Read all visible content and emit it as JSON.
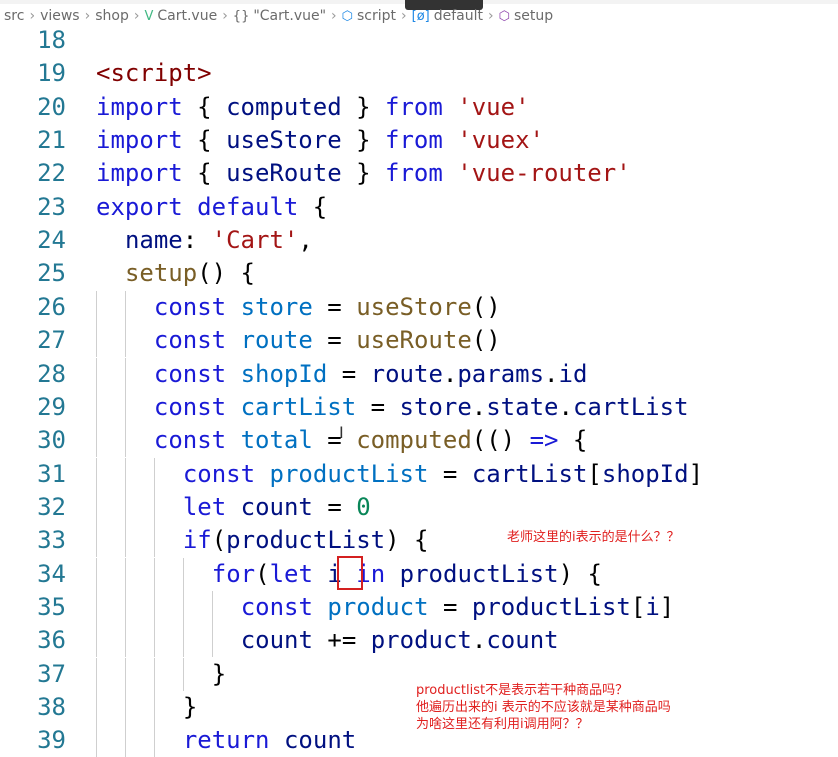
{
  "breadcrumb": [
    {
      "label": "src",
      "icon": ""
    },
    {
      "label": "views",
      "icon": ""
    },
    {
      "label": "shop",
      "icon": ""
    },
    {
      "label": "Cart.vue",
      "icon": "vue-icon"
    },
    {
      "label": "\"Cart.vue\"",
      "icon": "braces-icon"
    },
    {
      "label": "script",
      "icon": "cube-icon"
    },
    {
      "label": "default",
      "icon": "variable-icon"
    },
    {
      "label": "setup",
      "icon": "method-icon"
    }
  ],
  "colors": {
    "keyword": "#1a1ad6",
    "variable": "#0070c1",
    "function": "#795e26",
    "string": "#a31515",
    "number": "#098658",
    "annotation": "#e0201f"
  },
  "lines": [
    {
      "n": "18",
      "indent": 0,
      "tokens": []
    },
    {
      "n": "19",
      "indent": 0,
      "tokens": [
        [
          "<script>",
          "tag"
        ]
      ]
    },
    {
      "n": "20",
      "indent": 0,
      "tokens": [
        [
          "import",
          "kw"
        ],
        [
          " { ",
          "pl"
        ],
        [
          "computed",
          "txt"
        ],
        [
          " } ",
          "pl"
        ],
        [
          "from",
          "kw"
        ],
        [
          " ",
          "pl"
        ],
        [
          "'vue'",
          "str"
        ]
      ]
    },
    {
      "n": "21",
      "indent": 0,
      "tokens": [
        [
          "import",
          "kw"
        ],
        [
          " { ",
          "pl"
        ],
        [
          "useStore",
          "txt"
        ],
        [
          " } ",
          "pl"
        ],
        [
          "from",
          "kw"
        ],
        [
          " ",
          "pl"
        ],
        [
          "'vuex'",
          "str"
        ]
      ]
    },
    {
      "n": "22",
      "indent": 0,
      "tokens": [
        [
          "import",
          "kw"
        ],
        [
          " { ",
          "pl"
        ],
        [
          "useRoute",
          "txt"
        ],
        [
          " } ",
          "pl"
        ],
        [
          "from",
          "kw"
        ],
        [
          " ",
          "pl"
        ],
        [
          "'vue-router'",
          "str"
        ]
      ]
    },
    {
      "n": "23",
      "indent": 0,
      "tokens": [
        [
          "export",
          "kw"
        ],
        [
          " ",
          "pl"
        ],
        [
          "default",
          "kw"
        ],
        [
          " {",
          "pl"
        ]
      ]
    },
    {
      "n": "24",
      "indent": 1,
      "tokens": [
        [
          "name",
          "txt"
        ],
        [
          ": ",
          "pl"
        ],
        [
          "'Cart'",
          "str"
        ],
        [
          ",",
          "pl"
        ]
      ]
    },
    {
      "n": "25",
      "indent": 1,
      "tokens": [
        [
          "setup",
          "fn"
        ],
        [
          "() {",
          "pl"
        ]
      ]
    },
    {
      "n": "26",
      "indent": 2,
      "tokens": [
        [
          "const",
          "kw"
        ],
        [
          " ",
          "pl"
        ],
        [
          "store",
          "var"
        ],
        [
          " = ",
          "pl"
        ],
        [
          "useStore",
          "fn"
        ],
        [
          "()",
          "pl"
        ]
      ]
    },
    {
      "n": "27",
      "indent": 2,
      "tokens": [
        [
          "const",
          "kw"
        ],
        [
          " ",
          "pl"
        ],
        [
          "route",
          "var"
        ],
        [
          " = ",
          "pl"
        ],
        [
          "useRoute",
          "fn"
        ],
        [
          "()",
          "pl"
        ]
      ]
    },
    {
      "n": "28",
      "indent": 2,
      "tokens": [
        [
          "const",
          "kw"
        ],
        [
          " ",
          "pl"
        ],
        [
          "shopId",
          "var"
        ],
        [
          " = ",
          "pl"
        ],
        [
          "route",
          "txt"
        ],
        [
          ".",
          "pl"
        ],
        [
          "params",
          "txt"
        ],
        [
          ".",
          "pl"
        ],
        [
          "id",
          "txt"
        ]
      ]
    },
    {
      "n": "29",
      "indent": 2,
      "tokens": [
        [
          "const",
          "kw"
        ],
        [
          " ",
          "pl"
        ],
        [
          "cartList",
          "var"
        ],
        [
          " = ",
          "pl"
        ],
        [
          "store",
          "txt"
        ],
        [
          ".",
          "pl"
        ],
        [
          "state",
          "txt"
        ],
        [
          ".",
          "pl"
        ],
        [
          "cartList",
          "txt"
        ]
      ]
    },
    {
      "n": "30",
      "indent": 2,
      "tokens": [
        [
          "const",
          "kw"
        ],
        [
          " ",
          "pl"
        ],
        [
          "total",
          "var"
        ],
        [
          " = ",
          "pl"
        ],
        [
          "computed",
          "fn"
        ],
        [
          "(() ",
          "pl"
        ],
        [
          "=>",
          "kw"
        ],
        [
          " {",
          "pl"
        ]
      ]
    },
    {
      "n": "31",
      "indent": 3,
      "tokens": [
        [
          "const",
          "kw"
        ],
        [
          " ",
          "pl"
        ],
        [
          "productList",
          "var"
        ],
        [
          " = ",
          "pl"
        ],
        [
          "cartList",
          "txt"
        ],
        [
          "[",
          "pl"
        ],
        [
          "shopId",
          "txt"
        ],
        [
          "]",
          "pl"
        ]
      ]
    },
    {
      "n": "32",
      "indent": 3,
      "tokens": [
        [
          "let",
          "kw"
        ],
        [
          " ",
          "pl"
        ],
        [
          "count",
          "txt"
        ],
        [
          " = ",
          "pl"
        ],
        [
          "0",
          "num"
        ]
      ]
    },
    {
      "n": "33",
      "indent": 3,
      "tokens": [
        [
          "if",
          "kw"
        ],
        [
          "(",
          "pl"
        ],
        [
          "productList",
          "txt"
        ],
        [
          ") {",
          "pl"
        ]
      ]
    },
    {
      "n": "34",
      "indent": 4,
      "tokens": [
        [
          "for",
          "kw"
        ],
        [
          "(",
          "pl"
        ],
        [
          "let",
          "kw"
        ],
        [
          " ",
          "pl"
        ],
        [
          "i",
          "txt"
        ],
        [
          " ",
          "pl"
        ],
        [
          "in",
          "kw"
        ],
        [
          " ",
          "pl"
        ],
        [
          "productList",
          "txt"
        ],
        [
          ") {",
          "pl"
        ]
      ]
    },
    {
      "n": "35",
      "indent": 5,
      "tokens": [
        [
          "const",
          "kw"
        ],
        [
          " ",
          "pl"
        ],
        [
          "product",
          "var"
        ],
        [
          " = ",
          "pl"
        ],
        [
          "productList",
          "txt"
        ],
        [
          "[",
          "pl"
        ],
        [
          "i",
          "txt"
        ],
        [
          "]",
          "pl"
        ]
      ]
    },
    {
      "n": "36",
      "indent": 5,
      "tokens": [
        [
          "count",
          "txt"
        ],
        [
          " += ",
          "pl"
        ],
        [
          "product",
          "txt"
        ],
        [
          ".",
          "pl"
        ],
        [
          "count",
          "txt"
        ]
      ]
    },
    {
      "n": "37",
      "indent": 4,
      "tokens": [
        [
          "}",
          "pl"
        ]
      ]
    },
    {
      "n": "38",
      "indent": 3,
      "tokens": [
        [
          "}",
          "pl"
        ]
      ]
    },
    {
      "n": "39",
      "indent": 3,
      "tokens": [
        [
          "return",
          "kw"
        ],
        [
          " ",
          "pl"
        ],
        [
          "count",
          "txt"
        ]
      ]
    }
  ],
  "annotations": {
    "question1": "老师这里的i表示的是什么？？",
    "question2": [
      "productlist不是表示若干种商品吗？",
      "他遍历出来的i 表示的不应该就是某种商品吗",
      "为啥这里还有利用i调用阿？？"
    ]
  }
}
